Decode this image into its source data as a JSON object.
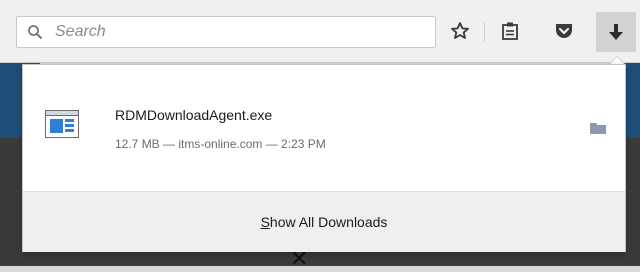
{
  "search": {
    "placeholder": "Search",
    "icon": "search-icon"
  },
  "toolbar": {
    "icons": [
      "star-icon",
      "clipboard-icon",
      "pocket-icon",
      "download-arrow-icon"
    ]
  },
  "downloads_panel": {
    "items": [
      {
        "file_name": "RDMDownloadAgent.exe",
        "status": "12.7 MB — itms-online.com — 2:23 PM",
        "icon": "exe-file-icon",
        "action_icon": "folder-icon"
      }
    ],
    "footer": {
      "label_first": "S",
      "label_rest": "how All Downloads"
    }
  },
  "colors": {
    "page_blue": "#1f4e79",
    "page_dark": "#3a3a3a",
    "accent_file_icon": "#2f7fd8"
  }
}
